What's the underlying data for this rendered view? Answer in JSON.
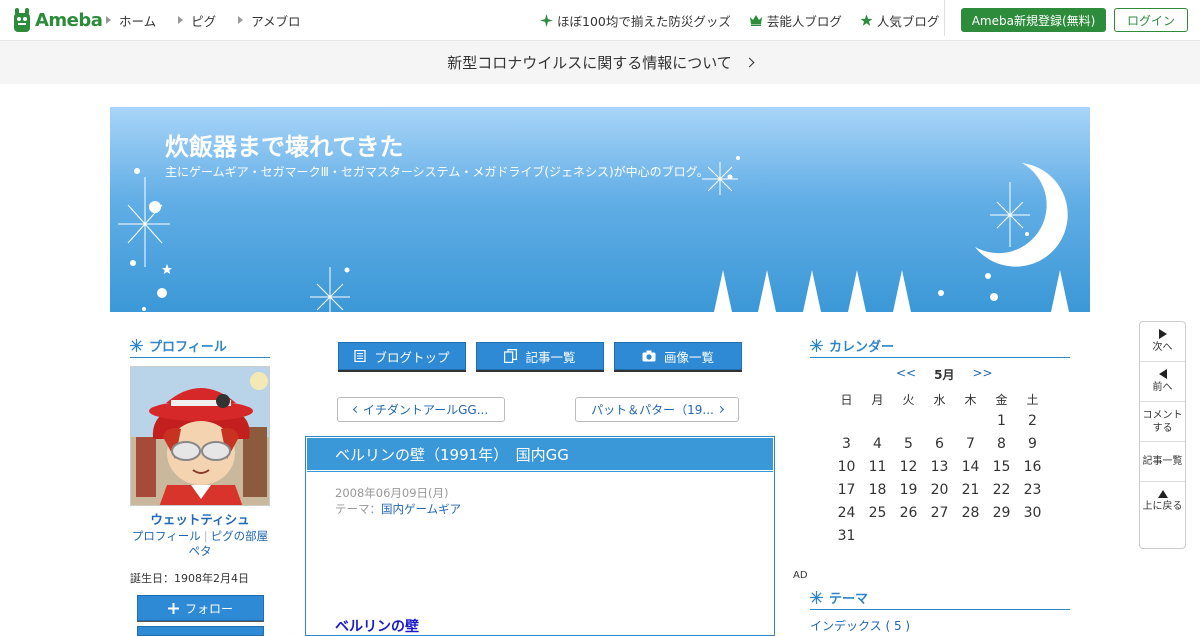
{
  "global_header": {
    "logo_text": "Ameba",
    "nav": [
      "ホーム",
      "ピグ",
      "アメブロ"
    ],
    "right_links": [
      {
        "label": "ほぼ100均で揃えた防災グッズ",
        "icon": "sparkle-icon"
      },
      {
        "label": "芸能人ブログ",
        "icon": "crown-icon"
      },
      {
        "label": "人気ブログ",
        "icon": "star-icon"
      }
    ],
    "register_label": "Ameba新規登録(無料)",
    "login_label": "ログイン"
  },
  "notice": {
    "text": "新型コロナウイルスに関する情報について"
  },
  "blog": {
    "title": "炊飯器まで壊れてきた",
    "description": "主にゲームギア・セガマークⅢ・セガマスターシステム・メガドライブ(ジェネシス)が中心のブログ。"
  },
  "profile": {
    "heading": "プロフィール",
    "name": "ウェットティシュ",
    "links": [
      "プロフィール",
      "ピグの部屋",
      "ペタ"
    ],
    "birthday": "誕生日：1908年2月4日",
    "follow_label": "フォロー"
  },
  "center_nav": {
    "buttons": [
      "ブログトップ",
      "記事一覧",
      "画像一覧"
    ],
    "prev_label": "イチダントアールGG...",
    "next_label": "パット＆パター（19..."
  },
  "article": {
    "title": "ベルリンの壁（1991年）　国内GG",
    "date": "2008年06月09日(月)",
    "theme_prefix": "テーマ：",
    "theme": "国内ゲームギア",
    "subheading": "ベルリンの壁"
  },
  "ad_label": "AD",
  "calendar": {
    "heading": "カレンダー",
    "prev": "<<",
    "month": "5月",
    "next": ">>",
    "weekdays": [
      "日",
      "月",
      "火",
      "水",
      "木",
      "金",
      "土"
    ],
    "weeks": [
      [
        "",
        "",
        "",
        "",
        "",
        "1",
        "2"
      ],
      [
        "3",
        "4",
        "5",
        "6",
        "7",
        "8",
        "9"
      ],
      [
        "10",
        "11",
        "12",
        "13",
        "14",
        "15",
        "16"
      ],
      [
        "17",
        "18",
        "19",
        "20",
        "21",
        "22",
        "23"
      ],
      [
        "24",
        "25",
        "26",
        "27",
        "28",
        "29",
        "30"
      ],
      [
        "31",
        "",
        "",
        "",
        "",
        "",
        ""
      ]
    ]
  },
  "theme_section": {
    "heading": "テーマ",
    "first_item": "インデックス ( 5 )"
  },
  "float_nav": {
    "next": "次へ",
    "prev": "前へ",
    "comment": "コメント\nする",
    "list": "記事一覧",
    "top": "上に戻る"
  },
  "colors": {
    "ameba_green": "#2d8c3c",
    "blog_blue": "#2e86c8",
    "link_blue": "#2166b3"
  }
}
